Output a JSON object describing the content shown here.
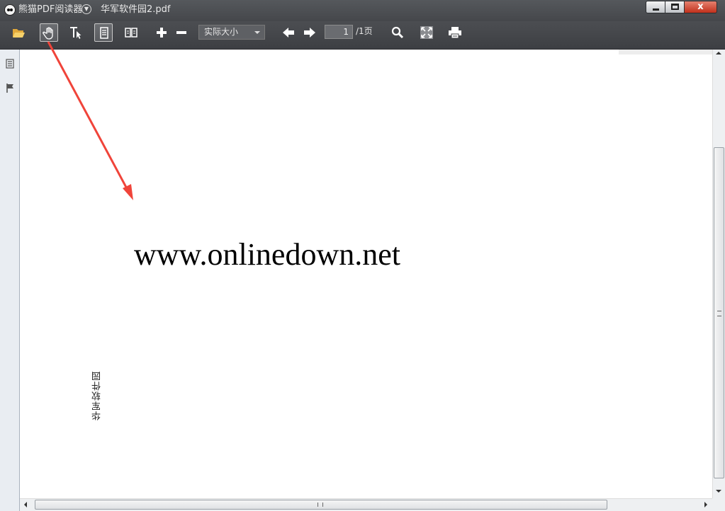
{
  "window": {
    "app_name": "熊猫PDF阅读器",
    "document_name": "华军软件园2.pdf",
    "close_label": "x"
  },
  "toolbar": {
    "buttons": [
      {
        "name": "open-file-button",
        "icon": "folder-open-icon"
      },
      {
        "name": "hand-tool-button",
        "icon": "hand-icon",
        "active": true
      },
      {
        "name": "select-text-button",
        "icon": "text-select-icon"
      },
      {
        "name": "single-page-button",
        "icon": "single-page-icon",
        "active": true
      },
      {
        "name": "two-page-button",
        "icon": "two-page-icon"
      },
      {
        "name": "zoom-in-button",
        "icon": "plus-icon"
      },
      {
        "name": "zoom-out-button",
        "icon": "minus-icon"
      },
      {
        "name": "prev-page-button",
        "icon": "arrow-left-icon"
      },
      {
        "name": "next-page-button",
        "icon": "arrow-right-icon"
      },
      {
        "name": "search-button",
        "icon": "search-icon"
      },
      {
        "name": "fullscreen-button",
        "icon": "fullscreen-icon"
      },
      {
        "name": "print-button",
        "icon": "printer-icon"
      }
    ],
    "zoom_value": "实际大小",
    "page_current": "1",
    "page_total": "/1页"
  },
  "sidebar": {
    "icons": [
      "outline-icon",
      "bookmark-flag-icon"
    ]
  },
  "document": {
    "url_text": "www.onlinedown.net",
    "vertical_text": "华军软件园"
  },
  "colors": {
    "titlebar": "#4a4c50",
    "annotation_arrow": "#f0443a",
    "close_button": "#c1301b"
  }
}
